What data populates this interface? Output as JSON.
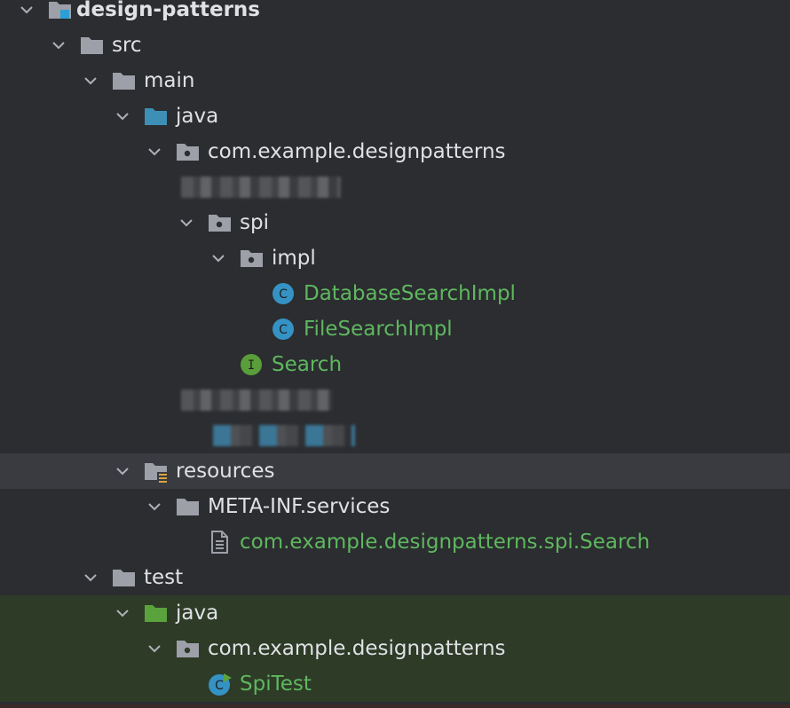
{
  "tree": {
    "project": "design-patterns",
    "src": "src",
    "main": "main",
    "main_java": "java",
    "main_package": "com.example.designpatterns",
    "spi": "spi",
    "impl": "impl",
    "database_search_impl": "DatabaseSearchImpl",
    "file_search_impl": "FileSearchImpl",
    "search": "Search",
    "resources": "resources",
    "meta_inf_services": "META-INF.services",
    "service_file": "com.example.designpatterns.spi.Search",
    "test": "test",
    "test_java": "java",
    "test_package": "com.example.designpatterns",
    "spi_test": "SpiTest"
  },
  "icon_letters": {
    "class": "C",
    "interface": "I"
  },
  "colors": {
    "background": "#2b2d30",
    "hover_row": "#393b40",
    "test_row": "#2d3b27",
    "folder": "#9da0a8",
    "source_root": "#3d8fb5",
    "test_root": "#5aa33c",
    "class_icon": "#3592c4",
    "interface_icon": "#5a9e3a",
    "green_text": "#5fb75f"
  },
  "icons": {
    "project": "module-folder-icon",
    "folder": "folder-icon",
    "package": "package-icon",
    "source_root": "source-root-folder-icon",
    "resources_root": "resources-root-folder-icon",
    "test_root": "test-root-folder-icon",
    "class": "class-icon",
    "interface": "interface-icon",
    "text_file": "text-file-icon",
    "test_class": "test-class-icon",
    "chevron": "chevron-down-icon"
  }
}
